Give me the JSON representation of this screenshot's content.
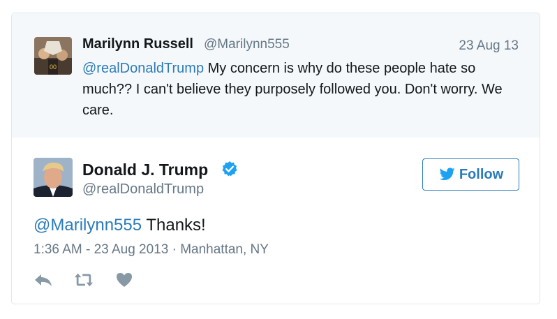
{
  "parent_tweet": {
    "author_name": "Marilynn Russell",
    "author_handle": "@Marilynn555",
    "date": "23 Aug 13",
    "mention": "@realDonaldTrump",
    "text": " My concern is why do these people hate so much?? I can't believe they purposely followed you. Don't worry. We care."
  },
  "main_tweet": {
    "author_name": "Donald J. Trump",
    "author_handle": "@realDonaldTrump",
    "follow_label": "Follow",
    "mention": "@Marilynn555",
    "text": " Thanks!",
    "timestamp": "1:36 AM - 23 Aug 2013",
    "separator": "·",
    "location": "Manhattan, NY"
  },
  "icons": {
    "verified": "verified-badge-icon",
    "bird": "twitter-bird-icon",
    "reply": "reply-icon",
    "retweet": "retweet-icon",
    "like": "heart-icon"
  },
  "colors": {
    "link": "#2b7bb9",
    "muted": "#657786",
    "verified": "#1da1f2",
    "parent_bg": "#f5f8fa",
    "action_icon": "#8899a6"
  }
}
